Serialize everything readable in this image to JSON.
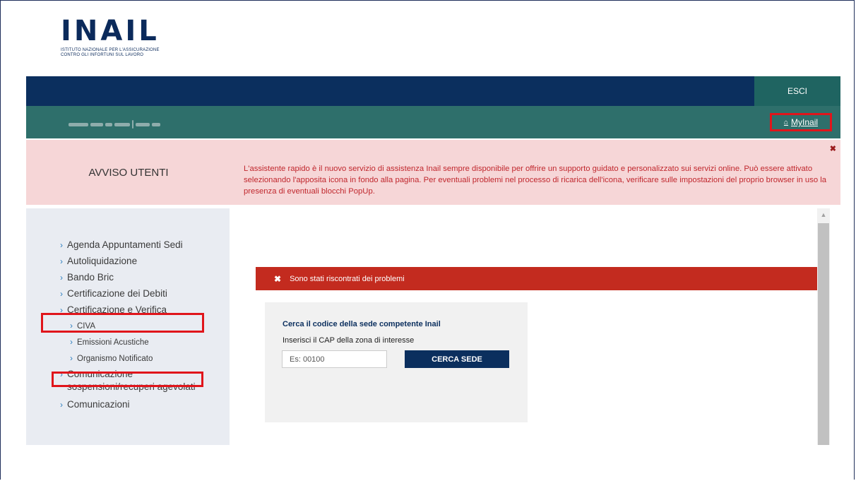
{
  "logo": {
    "wordmark": "INAIL",
    "tagline_line1": "ISTITUTO NAZIONALE PER L'ASSICURAZIONE",
    "tagline_line2": "CONTRO GLI INFORTUNI SUL LAVORO"
  },
  "header": {
    "logout_label": "ESCI",
    "mylnail_label": "MyInail"
  },
  "notice": {
    "title": "AVVISO UTENTI",
    "text": "L'assistente rapido è il nuovo servizio di assistenza Inail sempre disponibile per offrire un supporto guidato e personalizzato sui servizi online. Può essere attivato selezionando l'apposita icona in fondo alla pagina. Per eventuali problemi nel processo di ricarica dell'icona, verificare sulle impostazioni del proprio browser in uso la presenza di eventuali blocchi PopUp.",
    "close_glyph": "✖"
  },
  "sidebar": {
    "items": [
      {
        "label": "Agenda Appuntamenti Sedi"
      },
      {
        "label": "Autoliquidazione"
      },
      {
        "label": "Bando Bric"
      },
      {
        "label": "Certificazione dei Debiti"
      },
      {
        "label": "Certificazione e Verifica"
      },
      {
        "label": "CIVA"
      },
      {
        "label": "Emissioni Acustiche"
      },
      {
        "label": "Organismo Notificato"
      },
      {
        "label": "Comunicazione sospensioni/recuperi agevolati"
      },
      {
        "label": "Comunicazioni"
      }
    ]
  },
  "error": {
    "message": "Sono stati riscontrati dei problemi"
  },
  "search": {
    "title": "Cerca il codice della sede competente Inail",
    "label": "Inserisci il CAP della zona di interesse",
    "placeholder": "Es: 00100",
    "button_label": "CERCA SEDE"
  },
  "colors": {
    "navy": "#0b2f5e",
    "teal": "#2e6f6b",
    "highlight_red": "#e0151b",
    "error_red": "#c32b1f",
    "notice_bg": "#f6d6d7"
  }
}
